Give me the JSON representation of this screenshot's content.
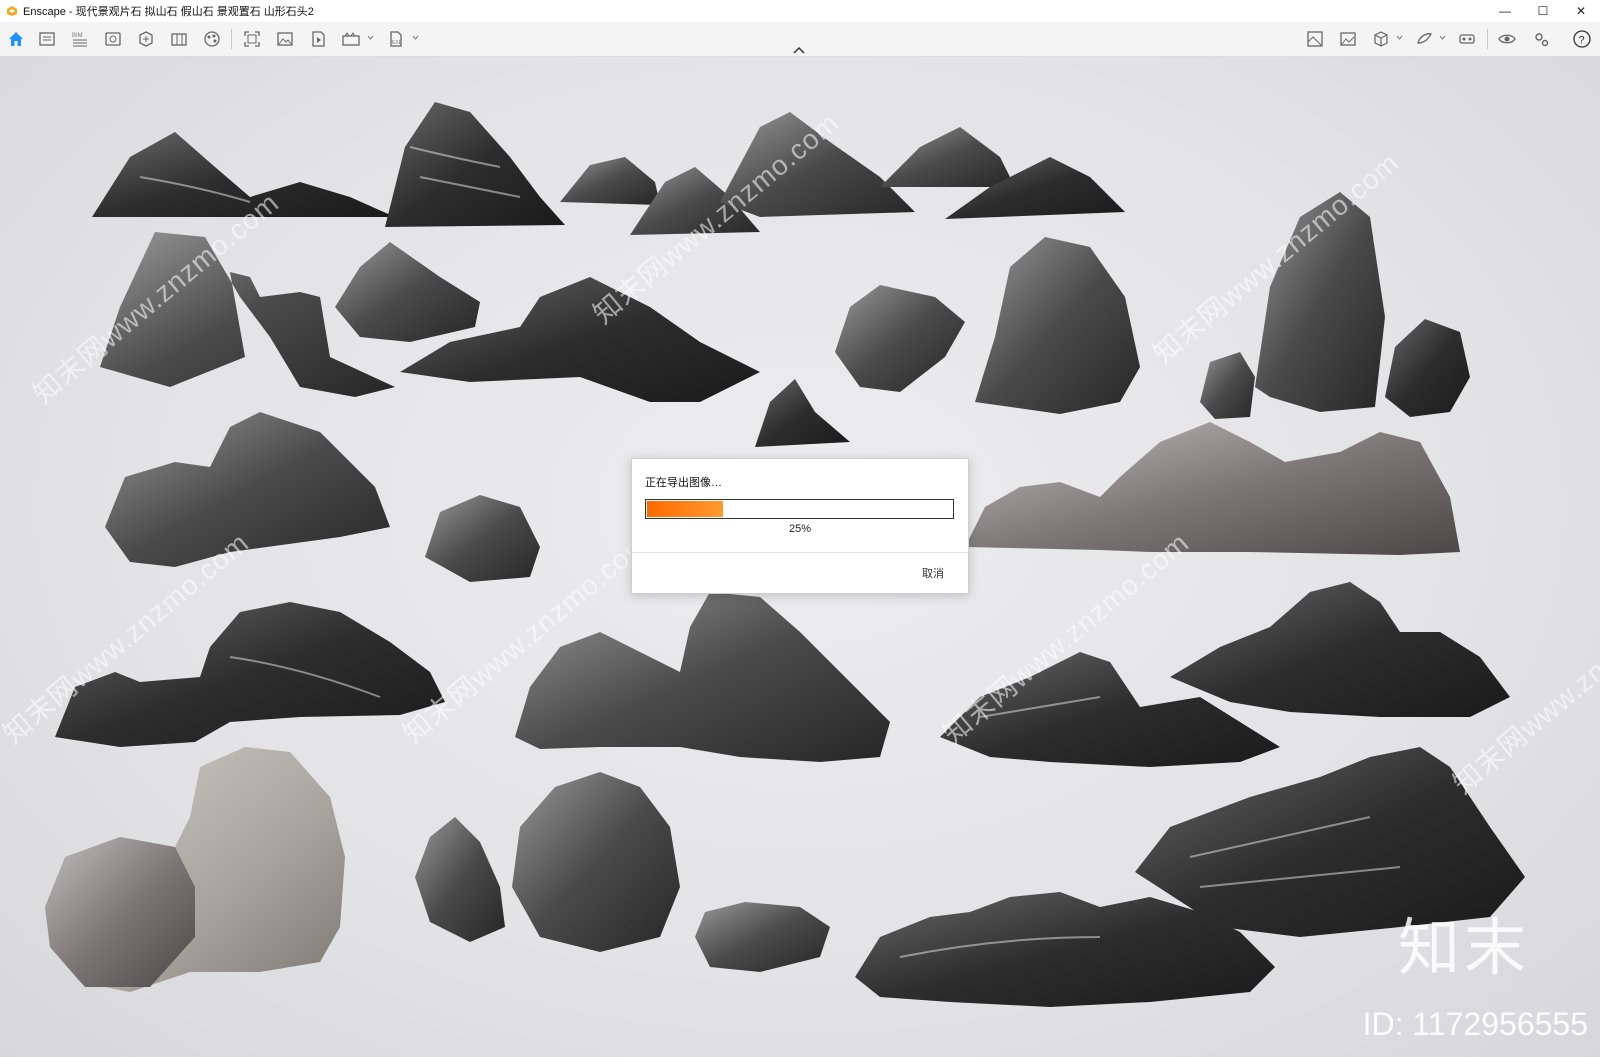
{
  "window": {
    "title": "Enscape - 现代景观片石 拟山石 假山石 景观置石 山形石头2",
    "controls": {
      "minimize": "—",
      "maximize": "☐",
      "close": "✕"
    }
  },
  "toolbar": {
    "left_icons": [
      "home-icon",
      "render-settings-icon",
      "bim-icon",
      "views-icon",
      "asset-library-icon",
      "material-icon",
      "atmosphere-icon",
      "screenshot-icon",
      "batch-render-icon",
      "video-editor-icon",
      "panorama-icon",
      "export-icon"
    ],
    "right_icons": [
      "visual-settings-icon",
      "image-icon",
      "cube-icon",
      "feedback-icon",
      "vr-headset-icon",
      "eye-icon",
      "settings-icon",
      "help-icon"
    ],
    "accent_color": "#1e90ff"
  },
  "dialog": {
    "title": "正在导出图像…",
    "progress_fraction": 0.25,
    "progress_text": "25%",
    "cancel_label": "取消",
    "fill_color": "#ff7a10"
  },
  "watermark": {
    "text": "知末网www.znzmo.com",
    "brand": "知末",
    "id": "ID: 1172956555"
  }
}
